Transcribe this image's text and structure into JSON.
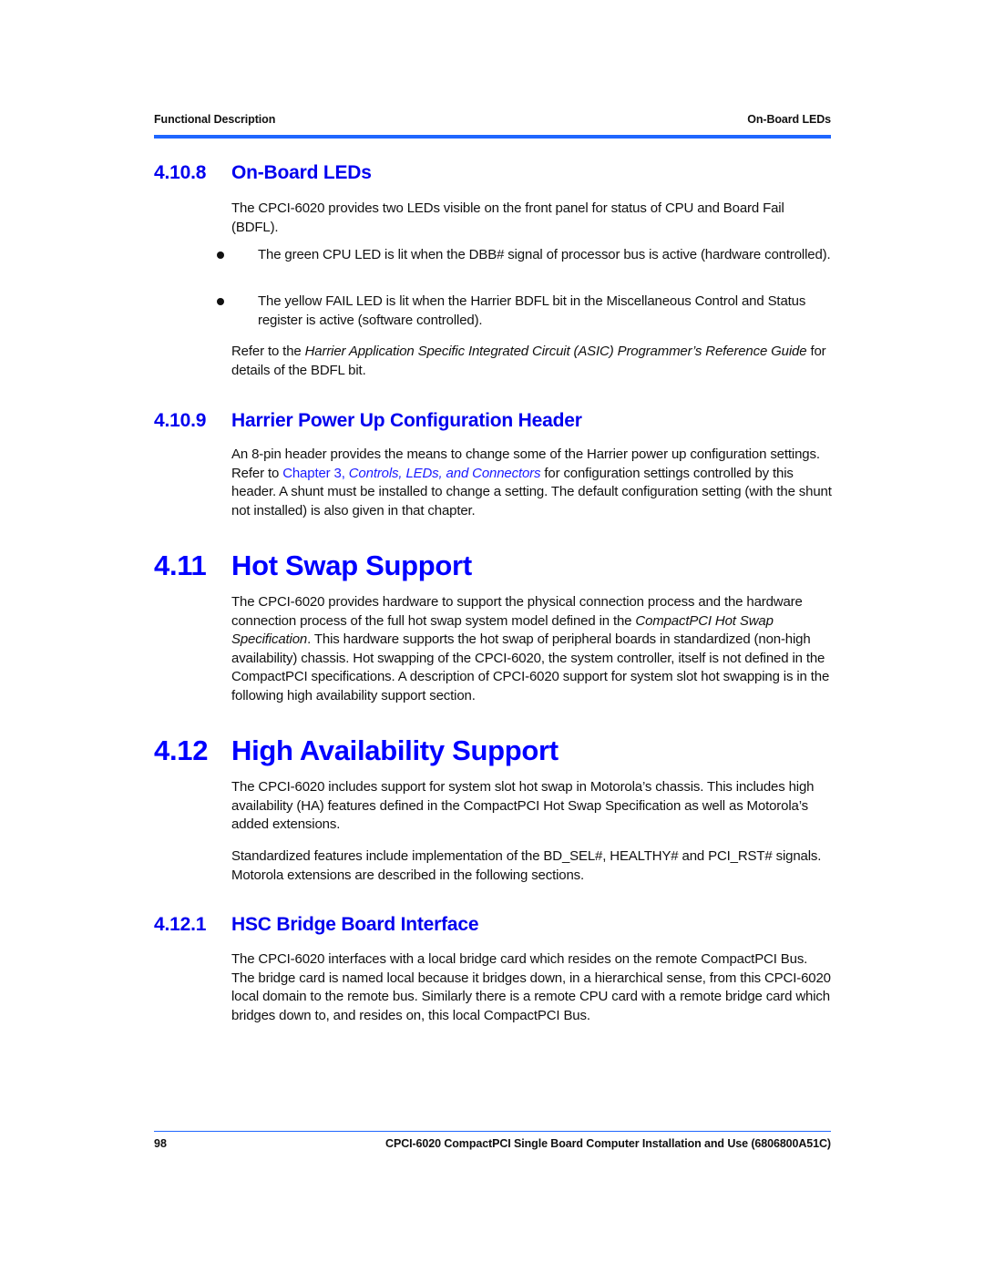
{
  "header": {
    "left": "Functional Description",
    "right": "On-Board LEDs",
    "rule_color": "#1f66ff"
  },
  "sections": {
    "onboard_leds": {
      "number": "4.10.8",
      "title": "On-Board LEDs",
      "intro": "The CPCI-6020 provides two LEDs visible on the front panel for status of CPU and Board Fail (BDFL).",
      "bullets": [
        "The green CPU LED is lit when the DBB# signal of processor bus is active (hardware controlled).",
        "The yellow FAIL LED is lit when the Harrier BDFL bit in the Miscellaneous Control and Status register is active (software controlled)."
      ],
      "refer_prefix": "Refer to the ",
      "refer_italic": "Harrier Application Specific Integrated Circuit (ASIC) Programmer’s Reference Guide",
      "refer_suffix": " for details of the BDFL bit."
    },
    "harrier_header": {
      "number": "4.10.9",
      "title": "Harrier Power Up Configuration Header",
      "text_1": "An 8-pin header provides the means to change some of the Harrier power up configuration settings. Refer to ",
      "link_chapter": "Chapter 3, ",
      "link_title": "Controls, LEDs, and Connectors",
      "text_2": " for configuration settings controlled by this header. A shunt must be installed to change a setting. The default configuration setting (with the shunt not installed) is also given in that chapter."
    },
    "hot_swap": {
      "number": "4.11",
      "title": "Hot Swap Support",
      "text_1": "The CPCI-6020 provides hardware to support the physical connection process and the hardware connection process of the full hot swap system model defined in the ",
      "italic": "CompactPCI Hot Swap Specification",
      "text_2": ". This hardware supports the hot swap of peripheral boards in standardized (non-high availability) chassis. Hot swapping of the CPCI-6020, the system controller, itself is not defined in the CompactPCI specifications. A description of CPCI-6020 support for system slot hot swapping is in the following high availability support section."
    },
    "high_availability": {
      "number": "4.12",
      "title": "High Availability Support",
      "para_1": "The CPCI-6020 includes support for system slot hot swap in Motorola’s chassis. This includes high availability (HA) features defined in the CompactPCI Hot Swap Specification as well as Motorola’s added extensions.",
      "para_2": "Standardized features include implementation of the BD_SEL#, HEALTHY# and PCI_RST# signals. Motorola extensions are described in the following sections."
    },
    "hsc_bridge": {
      "number": "4.12.1",
      "title": "HSC Bridge Board Interface",
      "para": "The CPCI-6020 interfaces with a local bridge card which resides on the remote CompactPCI Bus. The bridge card is named local because it bridges down, in a hierarchical sense, from this CPCI-6020 local domain to the remote bus. Similarly there is a remote CPU card with a remote bridge card which bridges down to, and resides on, this local CompactPCI Bus."
    }
  },
  "footer": {
    "page_number": "98",
    "title": "CPCI-6020 CompactPCI Single Board Computer Installation and Use (6806800A51C)"
  },
  "colors": {
    "heading_blue": "#0000ff",
    "link_blue": "#1a1aff",
    "body_text": "#111111"
  }
}
